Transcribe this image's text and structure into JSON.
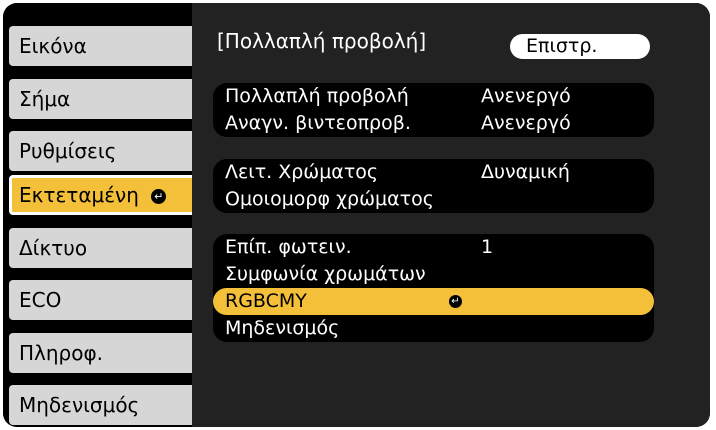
{
  "sidebar": {
    "items": [
      {
        "label": "Εικόνα"
      },
      {
        "label": "Σήμα"
      },
      {
        "label": "Ρυθμίσεις"
      },
      {
        "label": "Εκτεταμένη"
      },
      {
        "label": "Δίκτυο"
      },
      {
        "label": "ECO"
      },
      {
        "label": "Πληροφ."
      },
      {
        "label": "Μηδενισμός"
      }
    ],
    "active_icon": "enter-icon"
  },
  "panel": {
    "title": "[Πολλαπλή προβολή]",
    "back_label": "Επιστρ.",
    "groups": [
      {
        "rows": [
          {
            "label": "Πολλαπλή προβολή",
            "value": "Ανενεργό"
          },
          {
            "label": "Αναγν. βιντεοπροβ.",
            "value": "Ανενεργό"
          }
        ]
      },
      {
        "rows": [
          {
            "label": "Λειτ. Χρώματος",
            "value": "Δυναμική"
          },
          {
            "label": "Ομοιομορφ χρώματος"
          }
        ]
      },
      {
        "rows": [
          {
            "label": "Επίπ. φωτειν.",
            "value": "1"
          },
          {
            "label": "Συμφωνία χρωμάτων"
          },
          {
            "label": "RGBCMY",
            "icon": "enter-icon"
          },
          {
            "label": "Μηδενισμός"
          }
        ]
      }
    ]
  },
  "colors": {
    "accent": "#f4c03a",
    "menu_item": "#d6d6d6",
    "panel_bg": "#222222",
    "row_bg": "#000000",
    "back_button": "#ffffff"
  }
}
